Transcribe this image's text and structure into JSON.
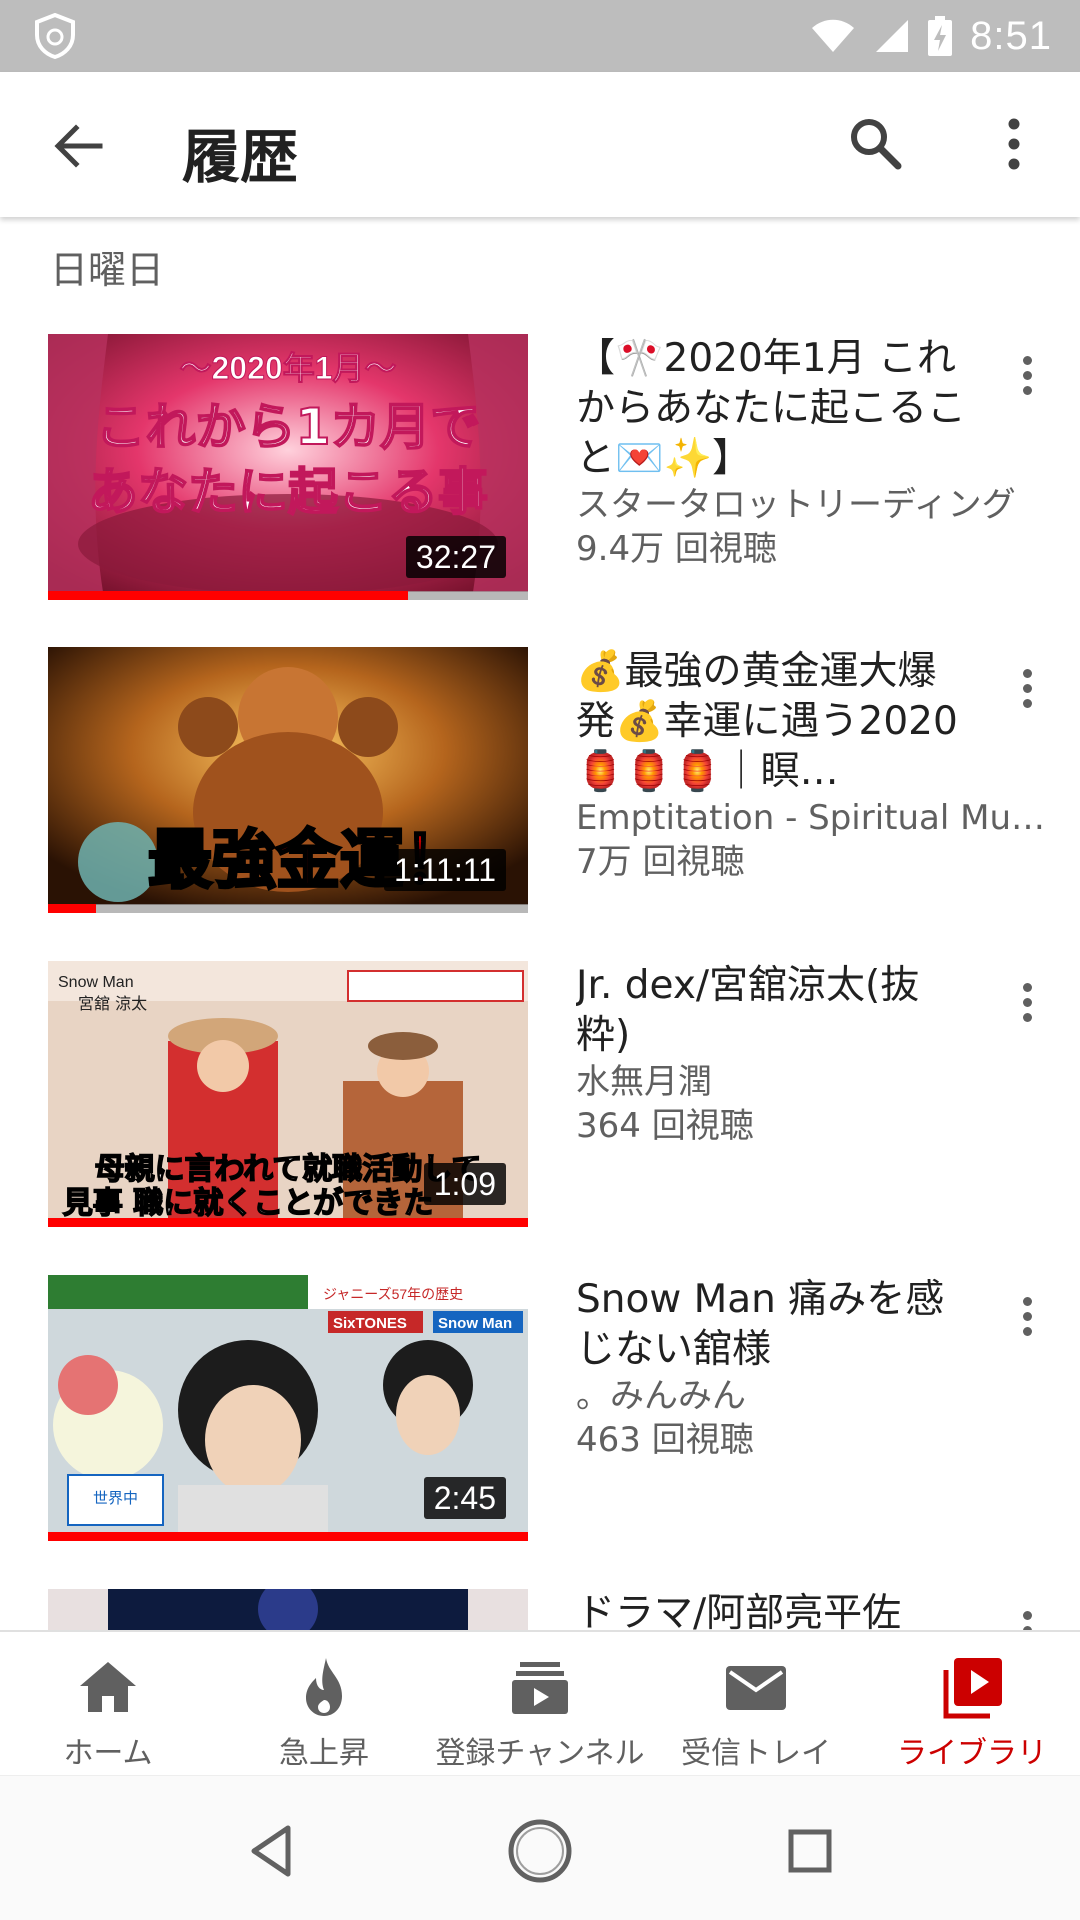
{
  "status_bar": {
    "time": "8:51"
  },
  "app_bar": {
    "title": "履歴"
  },
  "section": {
    "header": "日曜日"
  },
  "videos": [
    {
      "title": "【🎌2020年1月 これからあなたに起こること💌✨】",
      "channel": "スタータロットリーディング",
      "views": "9.4万 回視聴",
      "duration": "32:27",
      "progress": 0.75,
      "thumb_text": [
        "〜2020年1月〜",
        "これから1カ月で",
        "あなたに起こる事"
      ]
    },
    {
      "title": "💰最強の黄金運大爆発💰幸運に遇う2020🏮🏮🏮｜瞑…",
      "channel": "Emptitation - Spiritual Music…",
      "views": "7万 回視聴",
      "duration": "1:11:11",
      "progress": 0.1,
      "thumb_text": [
        "最強金運！"
      ]
    },
    {
      "title": "Jr. dex/宮舘涼太(抜粋)",
      "channel": "水無月潤",
      "views": "364 回視聴",
      "duration": "1:09",
      "progress": 1.0,
      "thumb_text": [
        "Snow Man",
        "宮舘 涼太",
        "母親に言われて就職活動して",
        "見事 職に就くことができた"
      ]
    },
    {
      "title": "Snow Man 痛みを感じない舘様",
      "channel": "。みんみん",
      "views": "463 回視聴",
      "duration": "2:45",
      "progress": 1.0,
      "thumb_text": [
        "ジャニーズ57年の歴史",
        "SixTONES",
        "Snow Man",
        "世界中"
      ]
    },
    {
      "title": "ドラマ/阿部亮平佐",
      "channel": "",
      "views": "",
      "duration": "",
      "progress": 0,
      "thumb_text": []
    }
  ],
  "bottom_nav": [
    {
      "label": "ホーム",
      "icon": "home-icon"
    },
    {
      "label": "急上昇",
      "icon": "trending-flame-icon"
    },
    {
      "label": "登録チャンネル",
      "icon": "subscriptions-icon"
    },
    {
      "label": "受信トレイ",
      "icon": "inbox-mail-icon"
    },
    {
      "label": "ライブラリ",
      "icon": "library-icon",
      "active": true
    }
  ],
  "colors": {
    "accent": "#cc0000",
    "progress": "#ff0000",
    "status_bar": "#bdbdbd"
  }
}
